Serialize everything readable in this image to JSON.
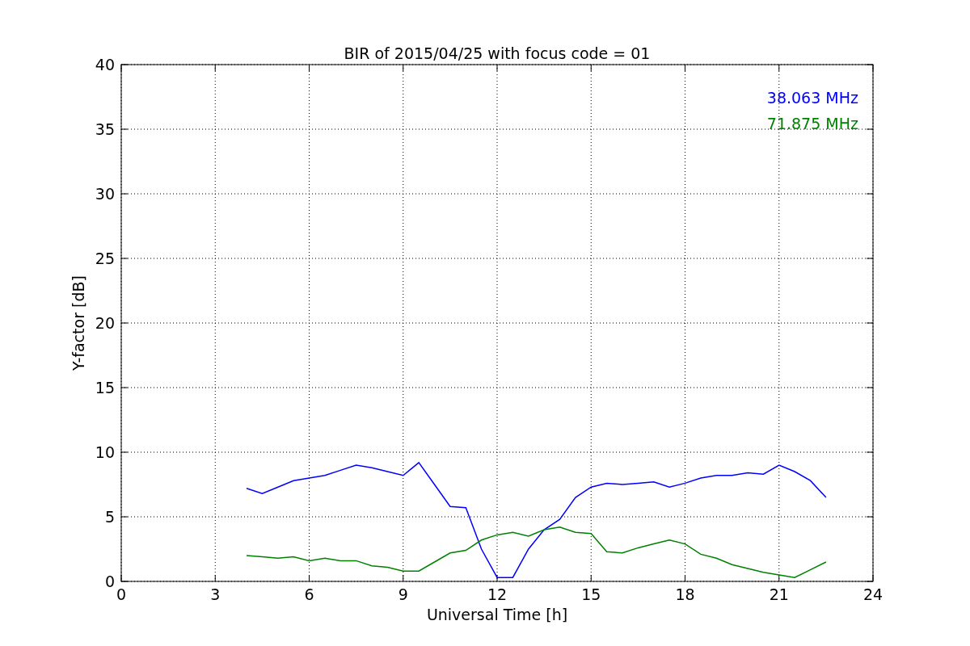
{
  "chart_data": {
    "type": "line",
    "title": "BIR of 2015/04/25 with focus code = 01",
    "xlabel": "Universal Time [h]",
    "ylabel": "Y-factor [dB]",
    "x": [
      4,
      4.5,
      5,
      5.5,
      6,
      6.5,
      7,
      7.5,
      8,
      8.5,
      9,
      9.5,
      10,
      10.5,
      11,
      11.5,
      12,
      12.5,
      13,
      13.5,
      14,
      14.5,
      15,
      15.5,
      16,
      16.5,
      17,
      17.5,
      18,
      18.5,
      19,
      19.5,
      20,
      20.5,
      21,
      21.5,
      22,
      22.5
    ],
    "series": [
      {
        "name": "38.063 MHz",
        "color": "#0000ff",
        "values": [
          7.2,
          6.8,
          7.3,
          7.8,
          8.0,
          8.2,
          8.6,
          9.0,
          8.8,
          8.5,
          8.2,
          9.2,
          7.5,
          5.8,
          5.7,
          2.5,
          0.3,
          0.3,
          2.5,
          4.0,
          4.8,
          6.5,
          7.3,
          7.6,
          7.5,
          7.6,
          7.7,
          7.3,
          7.6,
          8.0,
          8.2,
          8.2,
          8.4,
          8.3,
          9.0,
          8.5,
          7.8,
          6.5
        ]
      },
      {
        "name": "71.875 MHz",
        "color": "#008000",
        "values": [
          2.0,
          1.9,
          1.8,
          1.9,
          1.6,
          1.8,
          1.6,
          1.6,
          1.2,
          1.1,
          0.8,
          0.8,
          1.5,
          2.2,
          2.4,
          3.2,
          3.6,
          3.8,
          3.5,
          4.0,
          4.2,
          3.8,
          3.7,
          2.3,
          2.2,
          2.6,
          2.9,
          3.2,
          2.9,
          2.1,
          1.8,
          1.3,
          1.0,
          0.7,
          0.5,
          0.3,
          0.9,
          1.5
        ]
      }
    ],
    "xlim": [
      0,
      24
    ],
    "ylim": [
      0,
      40
    ],
    "xticks": [
      0,
      3,
      6,
      9,
      12,
      15,
      18,
      21,
      24
    ],
    "yticks": [
      0,
      5,
      10,
      15,
      20,
      25,
      30,
      35,
      40
    ],
    "grid": true
  }
}
